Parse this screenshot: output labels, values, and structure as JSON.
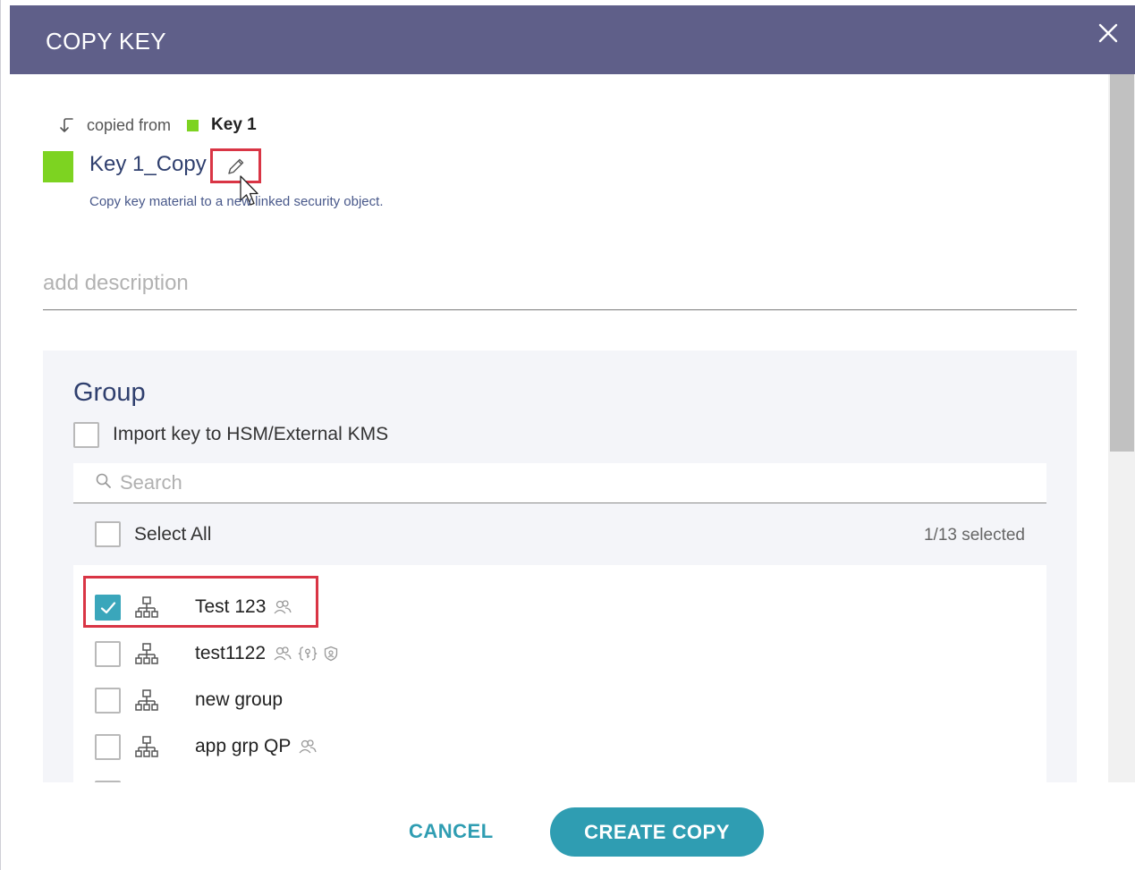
{
  "dialog": {
    "title": "COPY KEY",
    "close_icon": "close-icon"
  },
  "source": {
    "prefix": "copied from",
    "name": "Key 1",
    "color": "#7dd321"
  },
  "key": {
    "name": "Key 1_Copy",
    "color": "#7dd321",
    "description": "Copy key material to a new linked security object.",
    "edit_icon": "pencil-icon"
  },
  "description_field": {
    "value": "",
    "placeholder": "add description"
  },
  "group": {
    "title": "Group",
    "import_label": "Import key to HSM/External KMS",
    "import_checked": false,
    "search_placeholder": "Search",
    "search_value": "",
    "select_all_label": "Select All",
    "selected_count": "1/13 selected",
    "items": [
      {
        "name": "Test 123",
        "checked": true,
        "meta": [
          "users-icon"
        ]
      },
      {
        "name": "test1122",
        "checked": false,
        "meta": [
          "users-icon",
          "key-braces-icon",
          "shield-icon"
        ]
      },
      {
        "name": "new group",
        "checked": false,
        "meta": []
      },
      {
        "name": "app grp QP",
        "checked": false,
        "meta": [
          "users-icon"
        ]
      }
    ]
  },
  "footer": {
    "cancel_label": "CANCEL",
    "create_label": "CREATE COPY"
  },
  "colors": {
    "header_bg": "#5f5f89",
    "accent": "#2f9db2",
    "checkbox_checked": "#3aa6bb",
    "highlight": "#d93545"
  }
}
